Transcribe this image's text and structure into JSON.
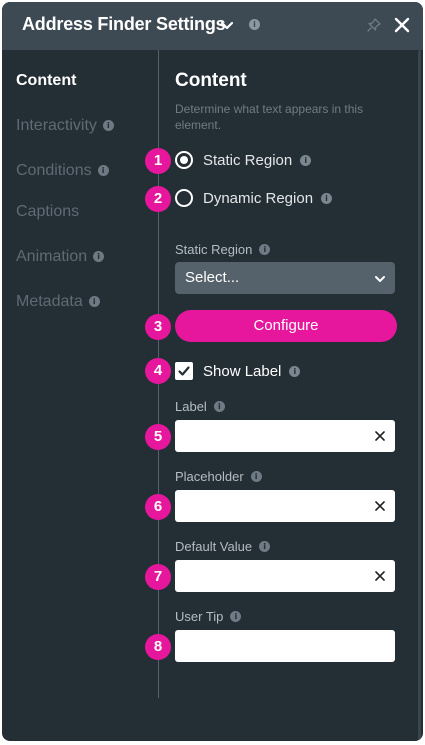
{
  "header": {
    "title": "Address Finder Settings",
    "info_glyph": "i"
  },
  "nav": {
    "items": [
      {
        "label": "Content",
        "active": true,
        "has_info": false
      },
      {
        "label": "Interactivity",
        "active": false,
        "has_info": true
      },
      {
        "label": "Conditions",
        "active": false,
        "has_info": true
      },
      {
        "label": "Captions",
        "active": false,
        "has_info": false
      },
      {
        "label": "Animation",
        "active": false,
        "has_info": true
      },
      {
        "label": "Metadata",
        "active": false,
        "has_info": true
      }
    ]
  },
  "content": {
    "title": "Content",
    "description": "Determine what text appears in this element.",
    "radio_static": {
      "label": "Static Region",
      "selected": true
    },
    "radio_dynamic": {
      "label": "Dynamic Region",
      "selected": false
    },
    "static_region": {
      "label": "Static Region",
      "value": "Select..."
    },
    "configure_label": "Configure",
    "show_label": {
      "label": "Show Label",
      "checked": true
    },
    "fields": {
      "label": {
        "label": "Label",
        "value": ""
      },
      "placeholder": {
        "label": "Placeholder",
        "value": ""
      },
      "default_value": {
        "label": "Default Value",
        "value": ""
      },
      "user_tip": {
        "label": "User Tip",
        "value": ""
      }
    }
  },
  "badges": [
    "1",
    "2",
    "3",
    "4",
    "5",
    "6",
    "7",
    "8"
  ],
  "colors": {
    "panel_bg": "#242e35",
    "header_bg": "#3d4a53",
    "accent": "#e6169d",
    "select_bg": "#56626b"
  }
}
